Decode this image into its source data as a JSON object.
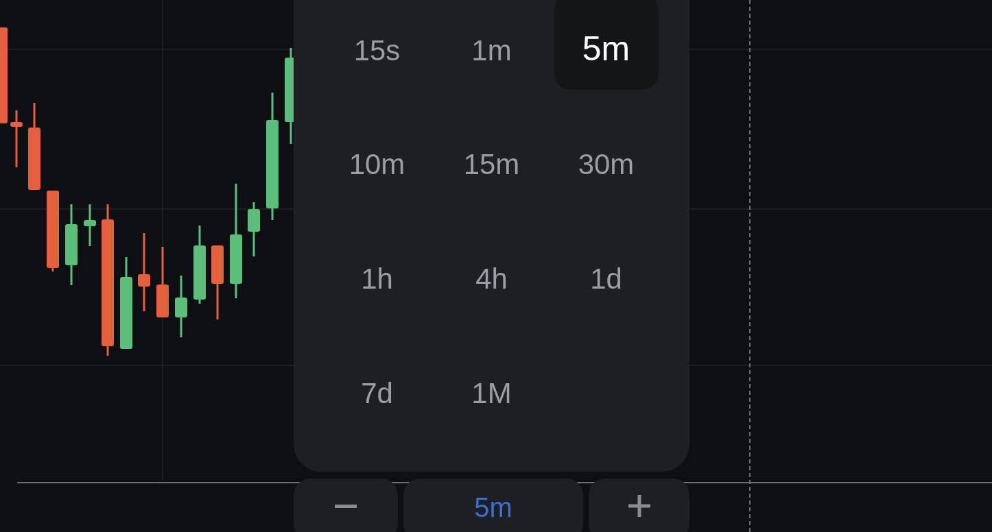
{
  "timeframe_menu": {
    "options": [
      {
        "label": "15s",
        "selected": false
      },
      {
        "label": "1m",
        "selected": false
      },
      {
        "label": "5m",
        "selected": true
      },
      {
        "label": "10m",
        "selected": false
      },
      {
        "label": "15m",
        "selected": false
      },
      {
        "label": "30m",
        "selected": false
      },
      {
        "label": "1h",
        "selected": false
      },
      {
        "label": "4h",
        "selected": false
      },
      {
        "label": "1d",
        "selected": false
      },
      {
        "label": "7d",
        "selected": false
      },
      {
        "label": "1M",
        "selected": false
      }
    ]
  },
  "interval_controls": [
    {
      "kind": "minus"
    },
    {
      "kind": "value",
      "label": "5m"
    },
    {
      "kind": "plus"
    }
  ]
}
